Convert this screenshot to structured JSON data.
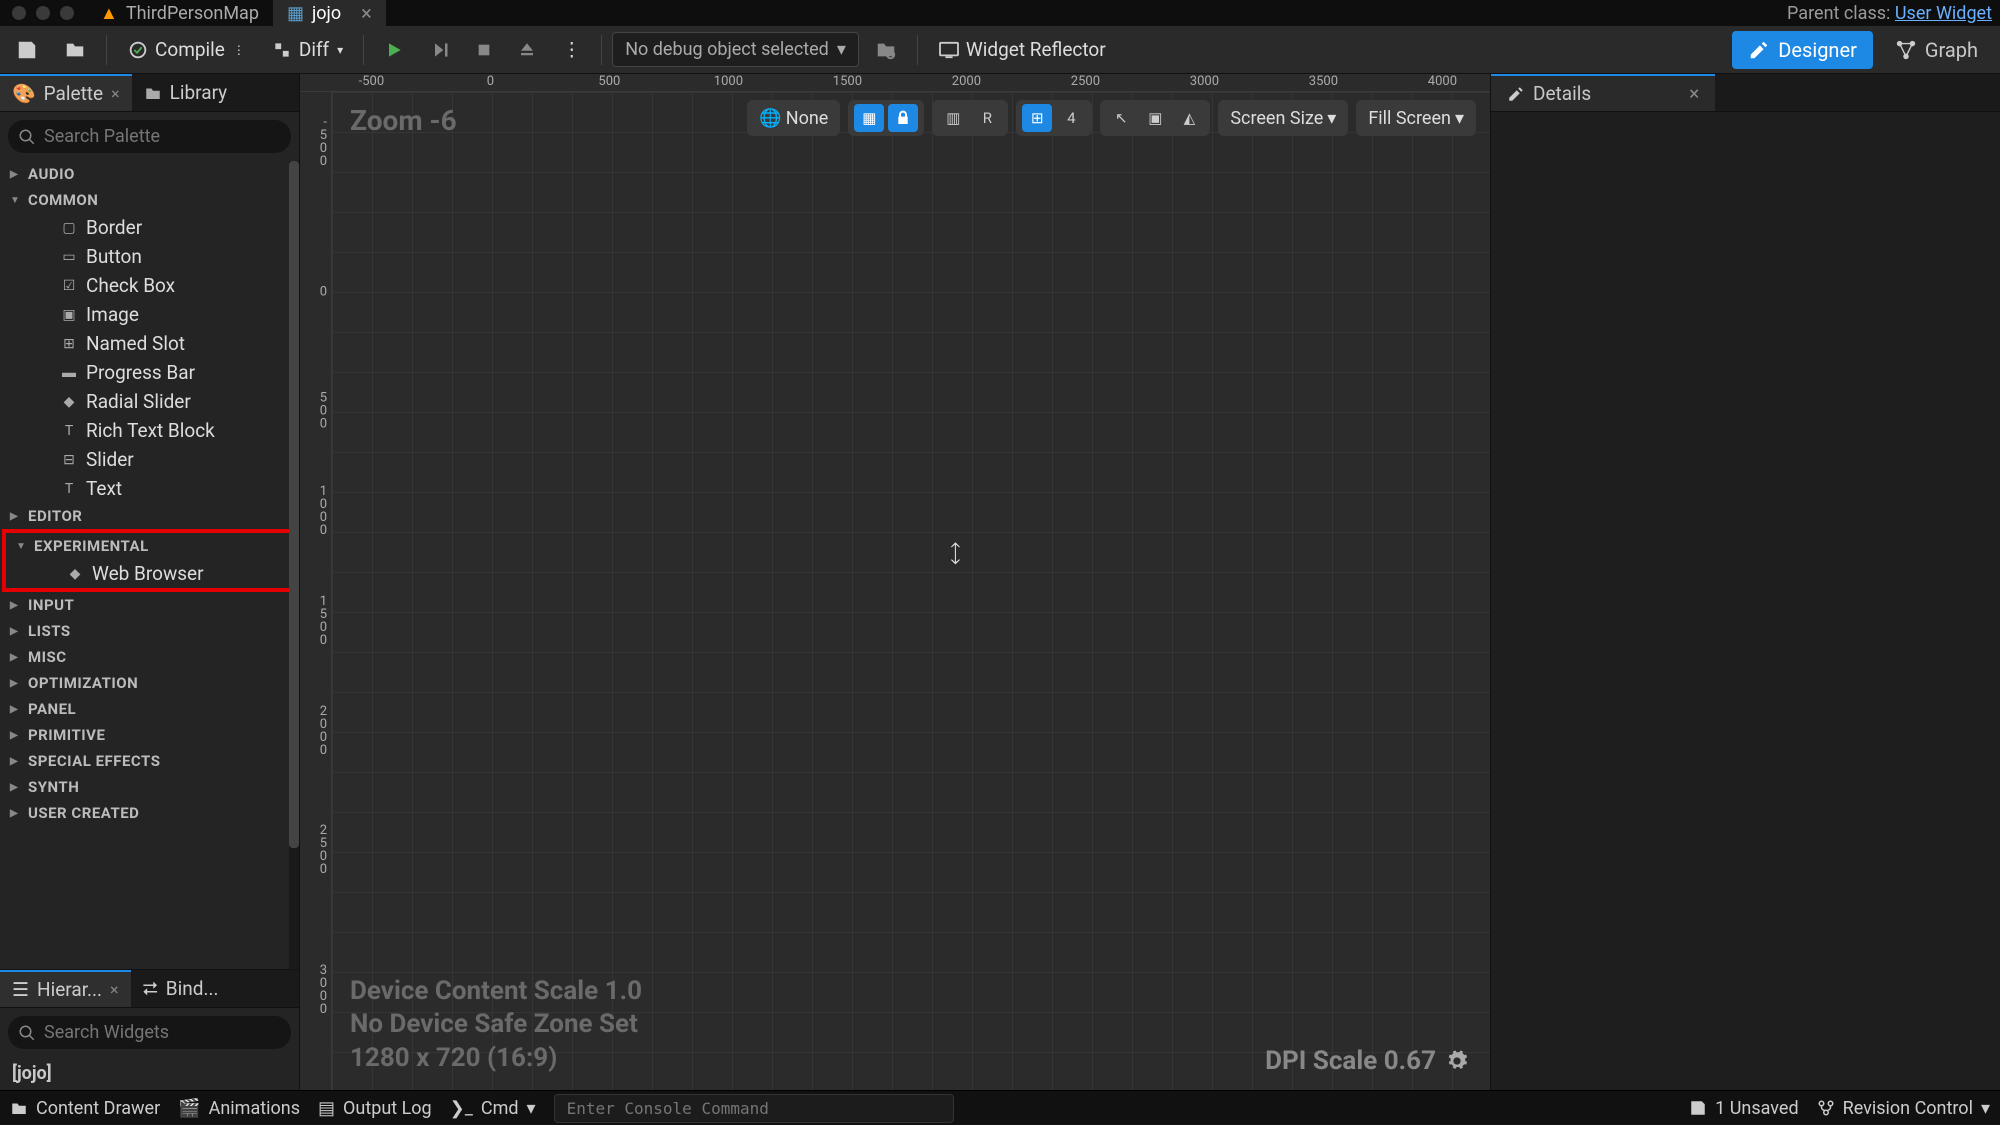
{
  "tabs": {
    "map": "ThirdPersonMap",
    "widget": "jojo"
  },
  "parent_class": {
    "label": "Parent class:",
    "value": "User Widget"
  },
  "toolbar": {
    "compile": "Compile",
    "diff": "Diff",
    "debug": "No debug object selected",
    "reflector": "Widget Reflector",
    "designer": "Designer",
    "graph": "Graph"
  },
  "panels": {
    "palette": "Palette",
    "library": "Library",
    "details": "Details",
    "hierarchy": "Hierar...",
    "bindings": "Bind..."
  },
  "search": {
    "palette_ph": "Search Palette",
    "widgets_ph": "Search Widgets"
  },
  "palette": {
    "audio": "AUDIO",
    "common": "COMMON",
    "common_items": [
      "Border",
      "Button",
      "Check Box",
      "Image",
      "Named Slot",
      "Progress Bar",
      "Radial Slider",
      "Rich Text Block",
      "Slider",
      "Text"
    ],
    "editor": "EDITOR",
    "experimental": "EXPERIMENTAL",
    "experimental_items": [
      "Web Browser"
    ],
    "input": "INPUT",
    "lists": "LISTS",
    "misc": "MISC",
    "optimization": "OPTIMIZATION",
    "panel": "PANEL",
    "primitive": "PRIMITIVE",
    "special": "SPECIAL EFFECTS",
    "synth": "SYNTH",
    "user": "USER CREATED"
  },
  "hierarchy": {
    "root": "[jojo]"
  },
  "canvas": {
    "zoom": "Zoom -6",
    "ruler_h": [
      "-500",
      "0",
      "500",
      "1000",
      "1500",
      "2000",
      "2500",
      "3000",
      "3500",
      "4000"
    ],
    "dev1": "Device Content Scale 1.0",
    "dev2": "No Device Safe Zone Set",
    "dev3": "1280 x 720 (16:9)",
    "dpi": "DPI Scale 0.67",
    "none": "None",
    "r": "R",
    "grid_n": "4",
    "screen": "Screen Size",
    "fill": "Fill Screen"
  },
  "footer": {
    "drawer": "Content Drawer",
    "anim": "Animations",
    "log": "Output Log",
    "cmd": "Cmd",
    "console_ph": "Enter Console Command",
    "unsaved": "1 Unsaved",
    "revision": "Revision Control"
  }
}
